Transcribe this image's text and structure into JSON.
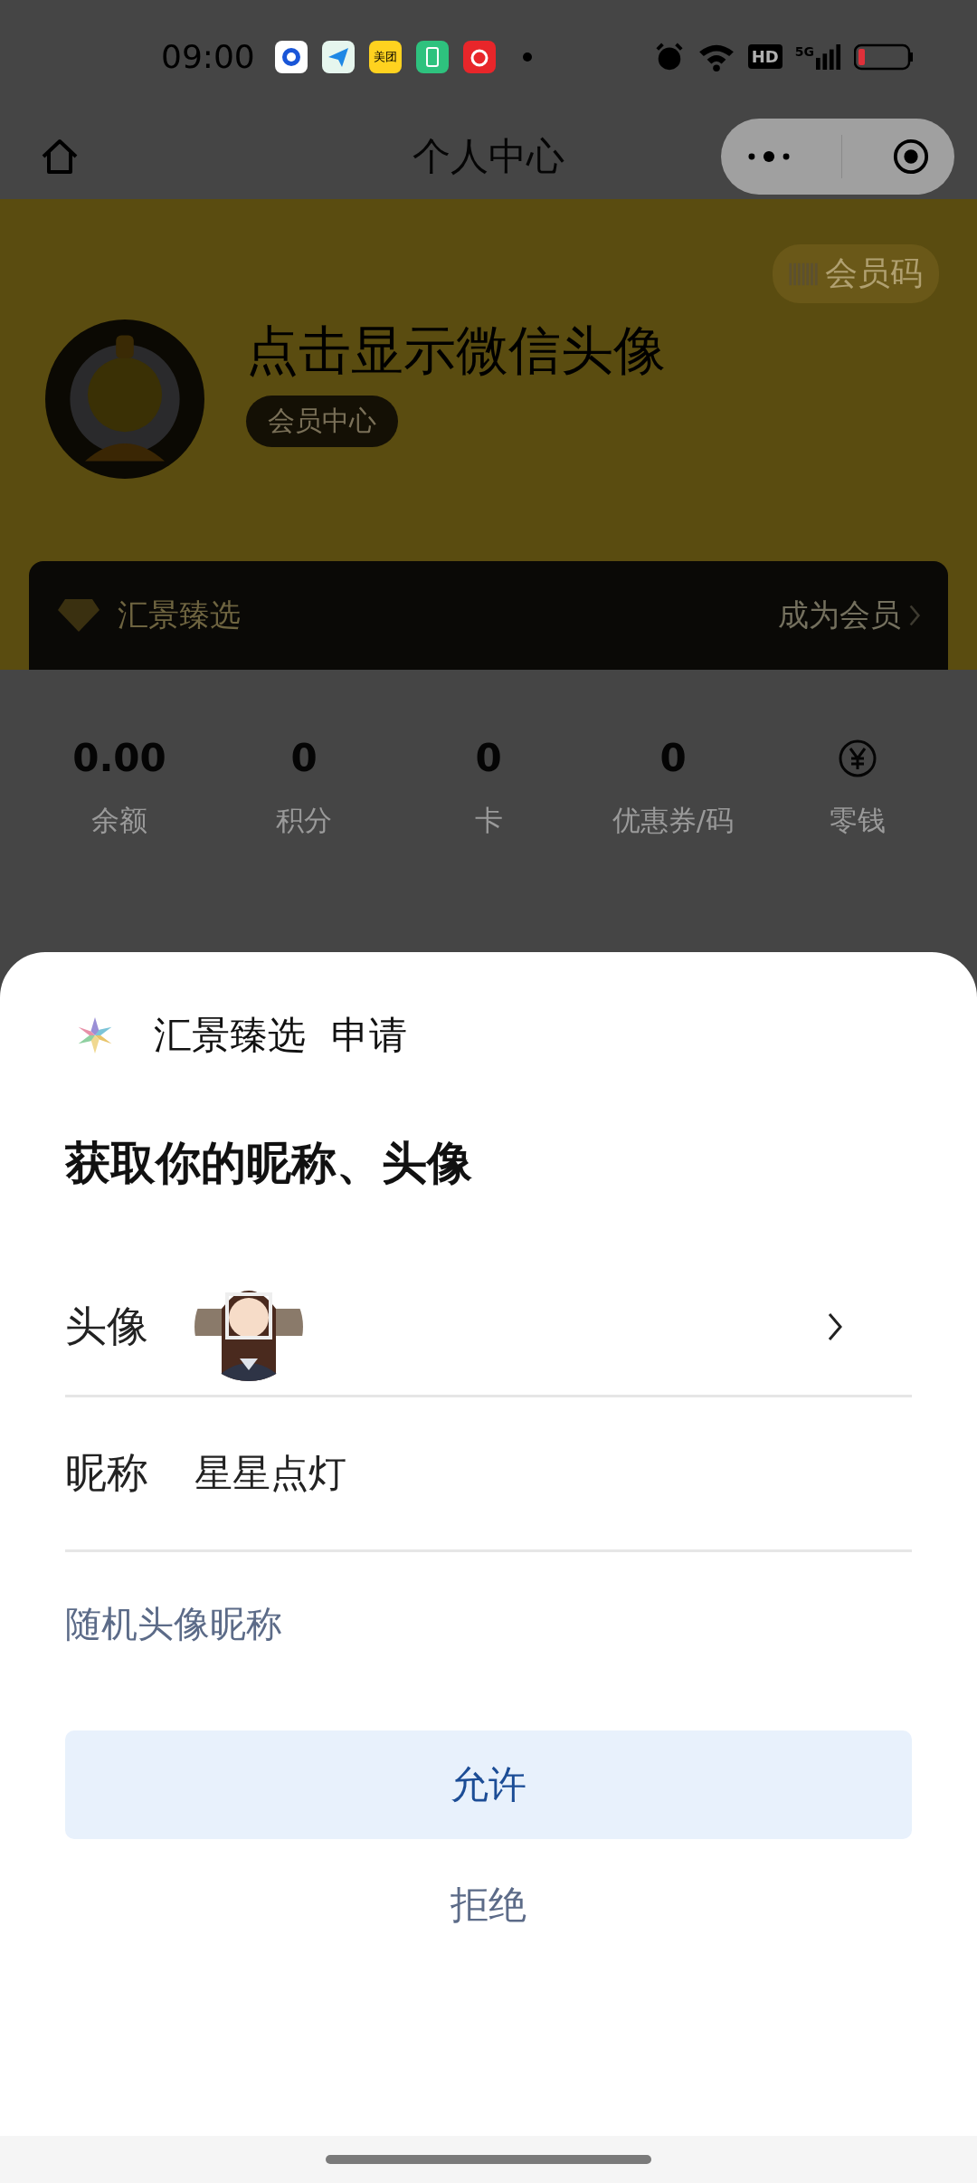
{
  "status_bar": {
    "time": "09:00",
    "notification_icons": [
      {
        "kind": "browser"
      },
      {
        "kind": "plane"
      },
      {
        "kind": "label",
        "label": "美团"
      },
      {
        "kind": "battery"
      },
      {
        "kind": "music"
      }
    ],
    "hd_label": "HD",
    "network_label": "5G"
  },
  "nav": {
    "title": "个人中心"
  },
  "profile": {
    "member_code": "会员码",
    "name": "点击显示微信头像",
    "badge": "会员中心",
    "membership_bar": {
      "brand": "汇景臻选",
      "action": "成为会员"
    }
  },
  "stats": [
    {
      "kind": "number",
      "value": "0.00",
      "label": "余额"
    },
    {
      "kind": "number",
      "value": "0",
      "label": "积分"
    },
    {
      "kind": "number",
      "value": "0",
      "label": "卡"
    },
    {
      "kind": "number",
      "value": "0",
      "label": "优惠券/码"
    },
    {
      "kind": "icon",
      "label": "零钱"
    }
  ],
  "sheet": {
    "app_name": "汇景臻选",
    "request": "申请",
    "title": "获取你的昵称、头像",
    "fields": [
      {
        "kind": "avatar",
        "label": "头像"
      },
      {
        "kind": "text",
        "label": "昵称",
        "value": "星星点灯"
      }
    ],
    "random_link": "随机头像昵称",
    "allow_button": "允许",
    "reject_button": "拒绝"
  }
}
